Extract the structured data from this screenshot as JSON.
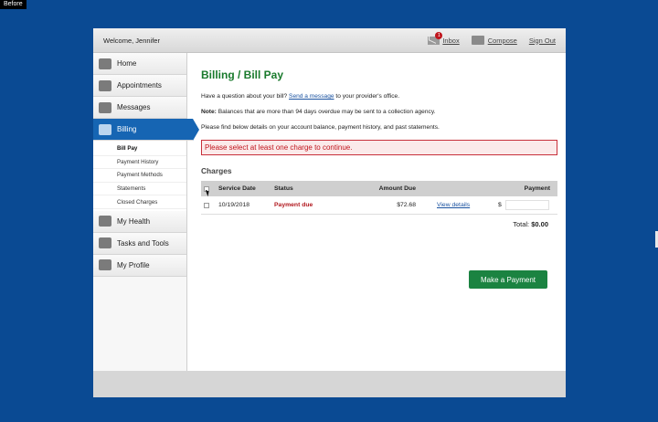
{
  "before_tag": "Before",
  "topbar": {
    "welcome": "Welcome, Jennifer",
    "inbox_label": "Inbox",
    "inbox_badge": "1",
    "compose_label": "Compose",
    "signout_label": "Sign Out"
  },
  "sidebar": {
    "items": [
      {
        "label": "Home",
        "icon": "home-icon"
      },
      {
        "label": "Appointments",
        "icon": "calendar-icon"
      },
      {
        "label": "Messages",
        "icon": "messages-icon"
      },
      {
        "label": "Billing",
        "icon": "billing-icon"
      },
      {
        "label": "My Health",
        "icon": "health-icon"
      },
      {
        "label": "Tasks and Tools",
        "icon": "tasks-icon"
      },
      {
        "label": "My Profile",
        "icon": "profile-icon"
      }
    ],
    "billing_sub": [
      "Bill Pay",
      "Payment History",
      "Payment Methods",
      "Statements",
      "Closed Charges"
    ]
  },
  "main": {
    "title": "Billing / Bill Pay",
    "question_prefix": "Have a question about your bill? ",
    "send_message_link": "Send a message",
    "question_suffix": " to your provider's office.",
    "note_label": "Note:",
    "note_text": " Balances that are more than 94 days overdue may be sent to a collection agency.",
    "details_text": "Please find below details on your account balance, payment history, and past statements.",
    "alert": "Please select at least one charge to continue.",
    "charges_heading": "Charges",
    "table": {
      "headers": {
        "date": "Service Date",
        "status": "Status",
        "amount": "Amount Due",
        "payment": "Payment"
      },
      "rows": [
        {
          "date": "10/19/2018",
          "status": "Payment due",
          "amount": "$72.68",
          "link": "View details",
          "currency": "$"
        }
      ]
    },
    "total_label": "Total: ",
    "total_value": "$0.00",
    "make_payment": "Make a Payment"
  },
  "colors": {
    "background": "#0a4a93",
    "title_green": "#197a2c",
    "active_nav": "#1665b3",
    "alert_red": "#c0141c",
    "button_green": "#1b8341"
  }
}
